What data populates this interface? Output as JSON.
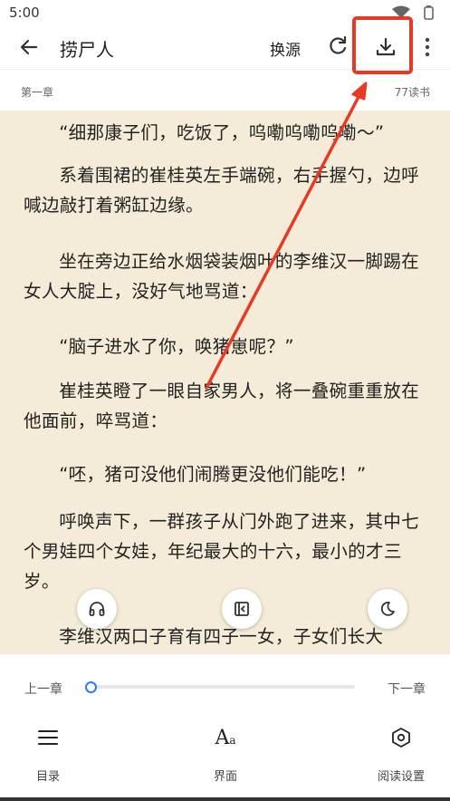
{
  "status_bar": {
    "time": "5:00"
  },
  "app_bar": {
    "title": "捞尸人",
    "source_label": "换源",
    "icons": [
      "back-arrow-icon",
      "refresh-icon",
      "download-icon",
      "more-vert-icon"
    ]
  },
  "chapter": {
    "name": "第一章",
    "readers": "77读书"
  },
  "content": {
    "paragraphs": [
      "“细那康子们，吃饭了，呜嘞呜嘞呜嘞～”",
      "系着围裙的崔桂英左手端碗，右手握勺，边呼喊边敲打着粥缸边缘。",
      "坐在旁边正给水烟袋装烟叶的李维汉一脚踢在女人大腚上，没好气地骂道：",
      "“脑子进水了你，唤猪崽呢？”",
      "崔桂英瞪了一眼自家男人，将一叠碗重重放在他面前，啐骂道：",
      "“呸，猪可没他们闹腾更没他们能吃！”",
      "呼唤声下，一群孩子从门外跑了进来，其中七个男娃四个女娃，年纪最大的十六，最小的才三岁。",
      "李维汉两口子育有四子一女，子女们长大"
    ]
  },
  "fabs": [
    "headphones-icon",
    "auto-page-icon",
    "night-mode-icon"
  ],
  "bottom_panel": {
    "prev_chapter": "上一章",
    "next_chapter": "下一章",
    "progress": 0.0,
    "nav": [
      {
        "label": "目录",
        "icon": "menu-list-icon"
      },
      {
        "label": "界面",
        "icon": "font-aa-icon"
      },
      {
        "label": "阅读设置",
        "icon": "settings-hexagon-icon"
      }
    ],
    "aa_big": "A",
    "aa_small": "a"
  },
  "colors": {
    "page_background": "#f4ecd8",
    "accent": "#2b7cf4",
    "annotation": "#e63a26"
  }
}
